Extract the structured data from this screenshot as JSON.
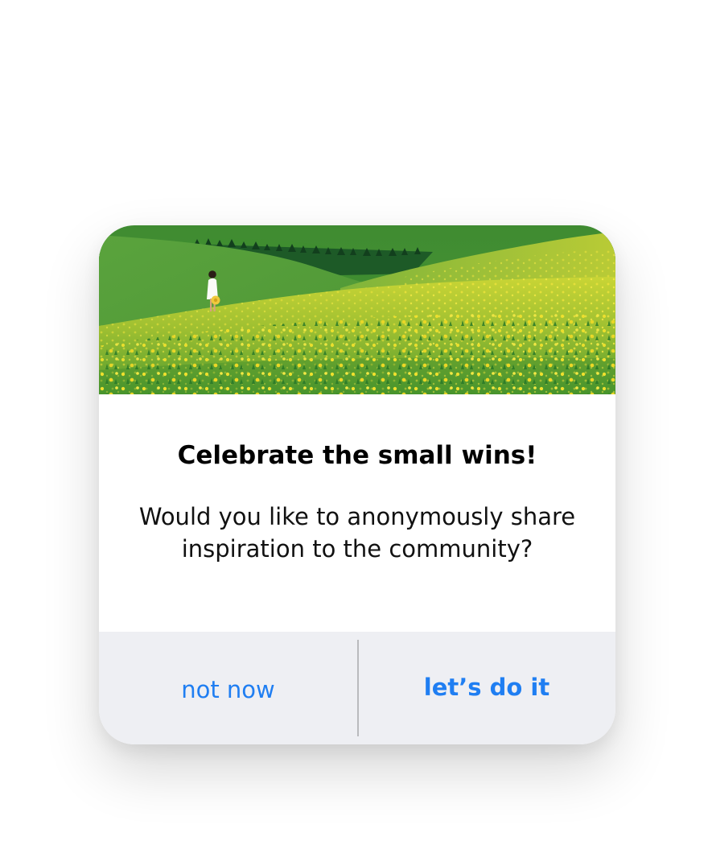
{
  "dialog": {
    "title": "Celebrate the small wins!",
    "message": "Would you like to anonymously share inspiration to the community?",
    "actions": {
      "secondary_label": "not now",
      "primary_label": "let’s do it"
    },
    "image_description_icon": "meadow-illustration"
  },
  "colors": {
    "accent": "#1f7ef2",
    "action_bar": "#eeeff3",
    "divider": "#b9babd",
    "meadow_green": "#4f9a35",
    "meadow_yellow": "#d6d82a",
    "forest": "#1f5a25"
  }
}
